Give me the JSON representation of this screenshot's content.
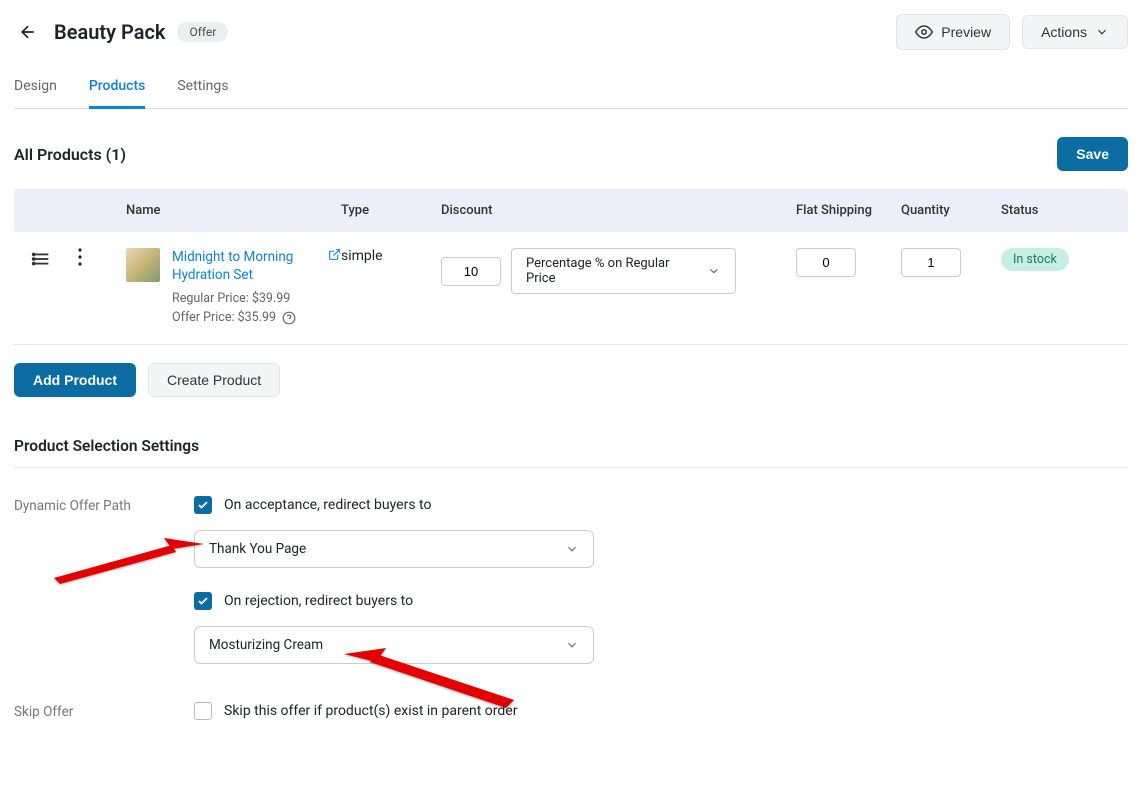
{
  "header": {
    "title": "Beauty Pack",
    "badge": "Offer",
    "preview_label": "Preview",
    "actions_label": "Actions"
  },
  "tabs": {
    "design": "Design",
    "products": "Products",
    "settings": "Settings"
  },
  "products_section": {
    "title": "All Products (1)",
    "save_label": "Save",
    "columns": {
      "name": "Name",
      "type": "Type",
      "discount": "Discount",
      "shipping": "Flat Shipping",
      "quantity": "Quantity",
      "status": "Status"
    },
    "row": {
      "name": "Midnight to Morning Hydration Set",
      "regular_price_label": "Regular Price: $39.99",
      "offer_price_label": "Offer Price: $35.99",
      "type": "simple",
      "discount_value": "10",
      "discount_type": "Percentage % on Regular Price",
      "shipping_value": "0",
      "quantity_value": "1",
      "status": "In stock"
    },
    "add_product_label": "Add Product",
    "create_product_label": "Create Product"
  },
  "selection_settings": {
    "title": "Product Selection Settings",
    "dynamic_path_label": "Dynamic Offer Path",
    "acceptance_label": "On acceptance, redirect buyers to",
    "acceptance_value": "Thank You Page",
    "rejection_label": "On rejection, redirect buyers to",
    "rejection_value": "Mosturizing Cream",
    "skip_offer_label": "Skip Offer",
    "skip_offer_checkbox_label": "Skip this offer if product(s) exist in parent order"
  }
}
